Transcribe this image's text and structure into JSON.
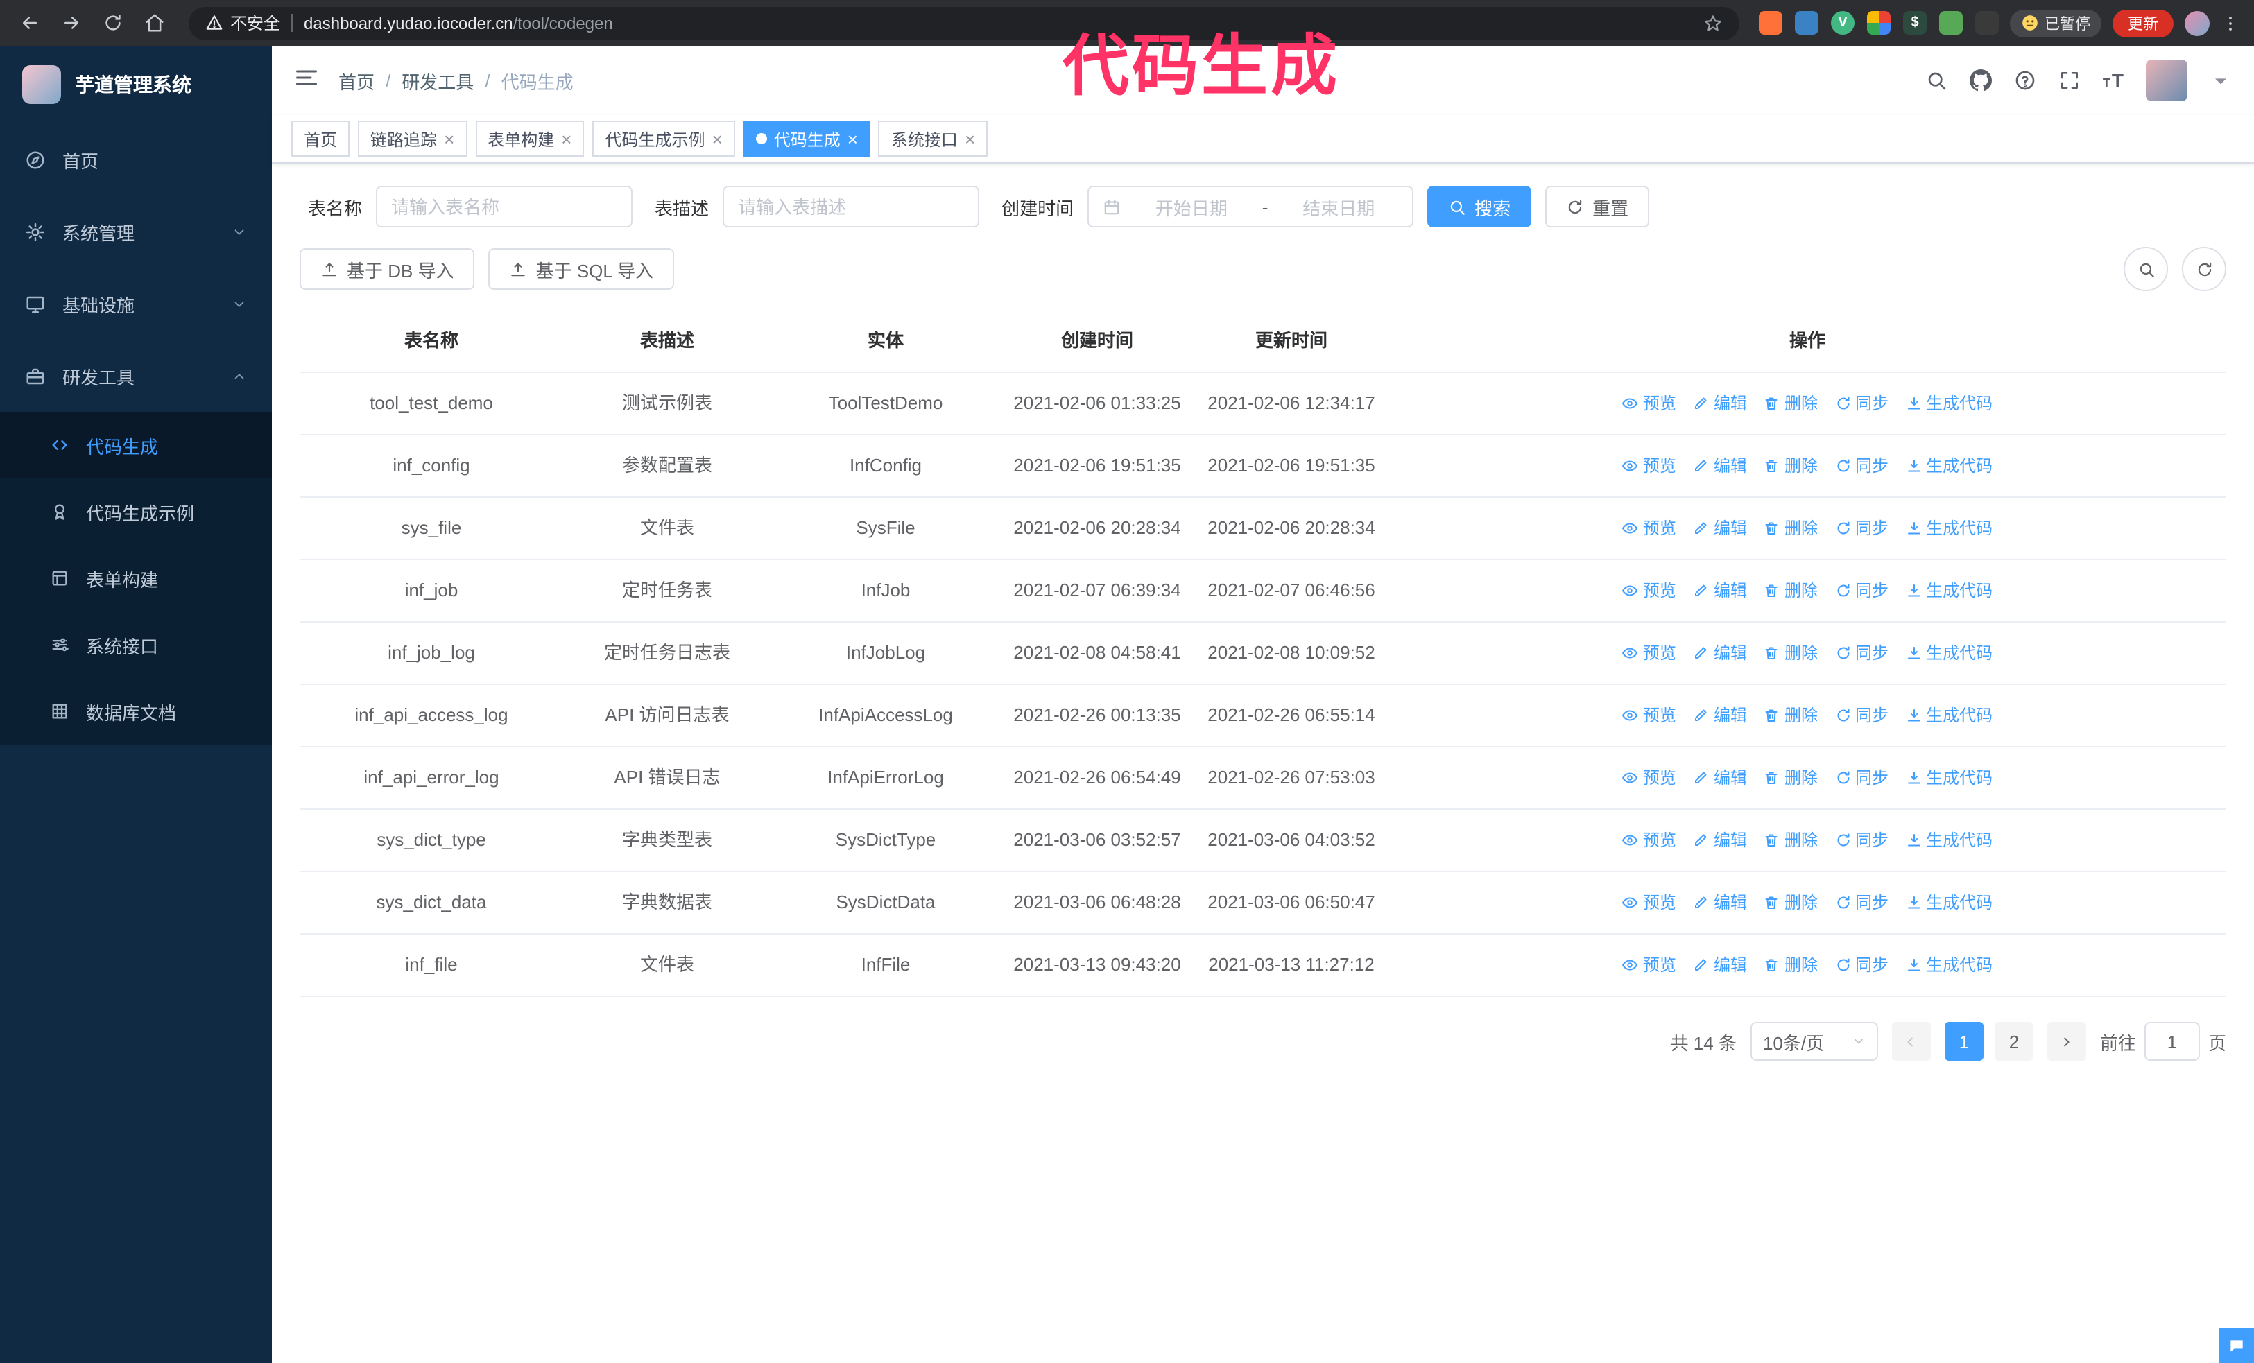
{
  "colors": {
    "accent": "#409eff",
    "sidebar_bg": "#102a43",
    "submenu_bg": "#0b1f33",
    "overlay": "#ff3366",
    "update_button_bg": "#d93025"
  },
  "overlay": {
    "title": "代码生成"
  },
  "browser": {
    "security_label": "不安全",
    "url_host": "dashboard.yudao.iocoder.cn",
    "url_path": "/tool/codegen",
    "paused_badge": "已暂停",
    "update_button": "更新",
    "extensions": [
      {
        "name": "orange-extension-icon",
        "color": "#ff7139",
        "glyph": ""
      },
      {
        "name": "blue-drop-extension-icon",
        "color": "#3b82c4",
        "glyph": ""
      },
      {
        "name": "vue-devtools-icon",
        "color": "#42b883",
        "glyph": "V"
      },
      {
        "name": "colorful-grid-extension-icon",
        "color": "#4285f4",
        "glyph": ""
      },
      {
        "name": "terminal-extension-icon",
        "color": "#2d4a3e",
        "glyph": "$"
      },
      {
        "name": "green-extension-icon",
        "color": "#57a957",
        "glyph": ""
      },
      {
        "name": "dark-knot-extension-icon",
        "color": "#3a3a3a",
        "glyph": ""
      }
    ]
  },
  "sidebar": {
    "app_title": "芋道管理系统",
    "items": [
      {
        "key": "home",
        "label": "首页",
        "icon": "dashboard",
        "arrow": "",
        "expanded": false
      },
      {
        "key": "system-management",
        "label": "系统管理",
        "icon": "gear",
        "arrow": "down",
        "expanded": false
      },
      {
        "key": "infrastructure",
        "label": "基础设施",
        "icon": "monitor",
        "arrow": "down",
        "expanded": false
      },
      {
        "key": "dev-tools",
        "label": "研发工具",
        "icon": "toolbox",
        "arrow": "up",
        "expanded": true
      }
    ],
    "sub_items": [
      {
        "key": "codegen",
        "label": "代码生成",
        "icon": "code",
        "active": true
      },
      {
        "key": "codegen-example",
        "label": "代码生成示例",
        "icon": "medal",
        "active": false
      },
      {
        "key": "form-builder",
        "label": "表单构建",
        "icon": "form",
        "active": false
      },
      {
        "key": "system-api",
        "label": "系统接口",
        "icon": "sliders",
        "active": false
      },
      {
        "key": "db-doc",
        "label": "数据库文档",
        "icon": "grid",
        "active": false
      }
    ]
  },
  "header": {
    "breadcrumb": [
      "首页",
      "研发工具",
      "代码生成"
    ]
  },
  "tabs": [
    {
      "key": "home",
      "label": "首页",
      "closable": false,
      "active": false
    },
    {
      "key": "trace",
      "label": "链路追踪",
      "closable": true,
      "active": false
    },
    {
      "key": "form-builder",
      "label": "表单构建",
      "closable": true,
      "active": false
    },
    {
      "key": "codegen-example",
      "label": "代码生成示例",
      "closable": true,
      "active": false
    },
    {
      "key": "codegen",
      "label": "代码生成",
      "closable": true,
      "active": true
    },
    {
      "key": "system-api",
      "label": "系统接口",
      "closable": true,
      "active": false
    }
  ],
  "filters": {
    "table_name_label": "表名称",
    "table_name_placeholder": "请输入表名称",
    "table_desc_label": "表描述",
    "table_desc_placeholder": "请输入表描述",
    "create_time_label": "创建时间",
    "date_start_placeholder": "开始日期",
    "date_separator": "-",
    "date_end_placeholder": "结束日期",
    "search_button": "搜索",
    "reset_button": "重置"
  },
  "toolbar": {
    "import_db_button": "基于 DB 导入",
    "import_sql_button": "基于 SQL 导入"
  },
  "table": {
    "columns": [
      "表名称",
      "表描述",
      "实体",
      "创建时间",
      "更新时间",
      "操作"
    ],
    "actions": [
      "预览",
      "编辑",
      "删除",
      "同步",
      "生成代码"
    ],
    "rows": [
      {
        "name": "tool_test_demo",
        "desc": "测试示例表",
        "entity": "ToolTestDemo",
        "created": "2021-02-06 01:33:25",
        "updated": "2021-02-06 12:34:17"
      },
      {
        "name": "inf_config",
        "desc": "参数配置表",
        "entity": "InfConfig",
        "created": "2021-02-06 19:51:35",
        "updated": "2021-02-06 19:51:35"
      },
      {
        "name": "sys_file",
        "desc": "文件表",
        "entity": "SysFile",
        "created": "2021-02-06 20:28:34",
        "updated": "2021-02-06 20:28:34"
      },
      {
        "name": "inf_job",
        "desc": "定时任务表",
        "entity": "InfJob",
        "created": "2021-02-07 06:39:34",
        "updated": "2021-02-07 06:46:56"
      },
      {
        "name": "inf_job_log",
        "desc": "定时任务日志表",
        "entity": "InfJobLog",
        "created": "2021-02-08 04:58:41",
        "updated": "2021-02-08 10:09:52"
      },
      {
        "name": "inf_api_access_log",
        "desc": "API 访问日志表",
        "entity": "InfApiAccessLog",
        "created": "2021-02-26 00:13:35",
        "updated": "2021-02-26 06:55:14"
      },
      {
        "name": "inf_api_error_log",
        "desc": "API 错误日志",
        "entity": "InfApiErrorLog",
        "created": "2021-02-26 06:54:49",
        "updated": "2021-02-26 07:53:03"
      },
      {
        "name": "sys_dict_type",
        "desc": "字典类型表",
        "entity": "SysDictType",
        "created": "2021-03-06 03:52:57",
        "updated": "2021-03-06 04:03:52"
      },
      {
        "name": "sys_dict_data",
        "desc": "字典数据表",
        "entity": "SysDictData",
        "created": "2021-03-06 06:48:28",
        "updated": "2021-03-06 06:50:47"
      },
      {
        "name": "inf_file",
        "desc": "文件表",
        "entity": "InfFile",
        "created": "2021-03-13 09:43:20",
        "updated": "2021-03-13 11:27:12"
      }
    ]
  },
  "pagination": {
    "total_text": "共 14 条",
    "page_size": "10条/页",
    "pages": [
      "1",
      "2"
    ],
    "active_page": "1",
    "goto_label": "前往",
    "goto_value": "1",
    "goto_suffix": "页"
  }
}
